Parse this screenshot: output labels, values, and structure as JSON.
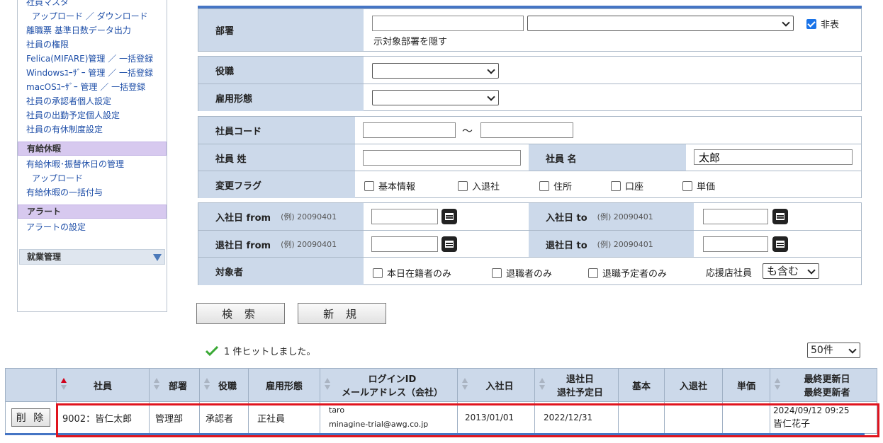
{
  "sidebar": {
    "items": [
      {
        "label": "社員マスタ",
        "sub": false
      },
      {
        "label": "アップロード ／ ダウンロード",
        "sub": true
      },
      {
        "label": "離職票 基準日数データ出力",
        "sub": false
      },
      {
        "label": "社員の権限",
        "sub": false
      },
      {
        "label": "Felica(MIFARE)管理 ／ 一括登録",
        "sub": false
      },
      {
        "label": "Windowsﾕｰｻﾞｰ 管理 ／ 一括登録",
        "sub": false
      },
      {
        "label": "macOSﾕｰｻﾞｰ 管理 ／ 一括登録",
        "sub": false
      },
      {
        "label": "社員の承認者個人設定",
        "sub": false
      },
      {
        "label": "社員の出勤予定個人設定",
        "sub": false
      },
      {
        "label": "社員の有休制度設定",
        "sub": false
      }
    ],
    "cat_paid_leave": "有給休暇",
    "paid_leave_items": [
      {
        "label": "有給休暇･振替休日の管理",
        "sub": false
      },
      {
        "label": "アップロード",
        "sub": true
      },
      {
        "label": "有給休暇の一括付与",
        "sub": false
      }
    ],
    "cat_alert": "アラート",
    "alert_items": [
      {
        "label": "アラートの設定",
        "sub": false
      }
    ],
    "collapsed_section": "就業管理"
  },
  "form": {
    "dept_label": "部署",
    "dept_checkbox_label": "非表",
    "dept_checkbox_label_wrap": "示対象部署を隠す",
    "dept_checkbox_checked": true,
    "position_label": "役職",
    "employment_label": "雇用形態",
    "code_label": "社員コード",
    "code_tilde": "～",
    "lastname_label": "社員 姓",
    "firstname_label": "社員 名",
    "firstname_value": "太郎",
    "flag_label": "変更フラグ",
    "flags": [
      "基本情報",
      "入退社",
      "住所",
      "口座",
      "単価"
    ],
    "hire_from_label": "入社日 from",
    "hire_to_label": "入社日 to",
    "leave_from_label": "退社日 from",
    "leave_to_label": "退社日 to",
    "date_example": "(例) 20090401",
    "target_label": "対象者",
    "target_options": [
      "本日在籍者のみ",
      "退職者のみ",
      "退職予定者のみ"
    ],
    "support_label": "応援店社員",
    "support_value": "も含む"
  },
  "buttons": {
    "search": "検 索",
    "new": "新 規"
  },
  "result": {
    "message": "1 件ヒットしました。",
    "per_page": "50件"
  },
  "table": {
    "headers": {
      "employee": "社員",
      "dept": "部署",
      "position": "役職",
      "employment": "雇用形態",
      "login1": "ログインID",
      "login2": "メールアドレス（会社）",
      "hire": "入社日",
      "leave1": "退社日",
      "leave2": "退社予定日",
      "basic": "基本",
      "joinleave": "入退社",
      "price": "単価",
      "updated1": "最終更新日",
      "updated2": "最終更新者"
    },
    "row": {
      "delete": "削 除",
      "employee": "9002：皆仁太郎",
      "dept": "管理部",
      "position": "承認者",
      "employment": "正社員",
      "login_id": "taro",
      "email": "minagine-trial@awg.co.jp",
      "hire": "2013/01/01",
      "leave": "2022/12/31",
      "basic": "",
      "joinleave": "",
      "price": "",
      "updated_date": "2024/09/12 09:25",
      "updated_by": "皆仁花子"
    }
  },
  "colors": {
    "label_bg": "#ccd9ea",
    "link": "#1f4fa8",
    "category_bg": "#d7c9ef",
    "highlight": "#e0141e",
    "check_green": "#3aa935"
  }
}
